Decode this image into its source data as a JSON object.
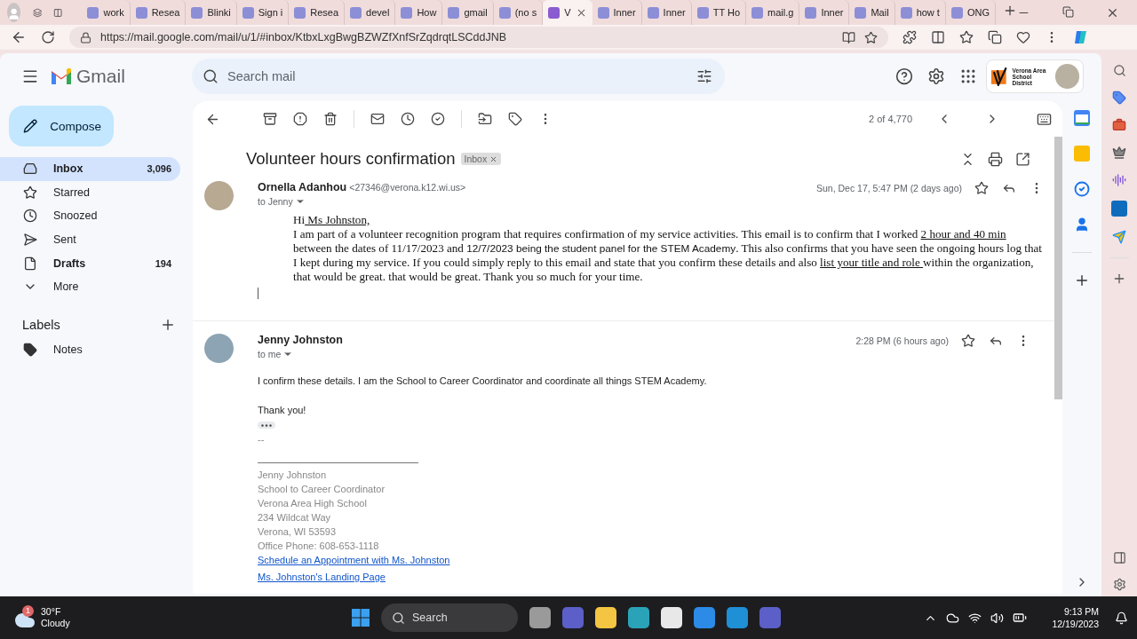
{
  "browser": {
    "tabs": [
      {
        "label": "work",
        "selected": false
      },
      {
        "label": "Resea",
        "selected": false
      },
      {
        "label": "Blinki",
        "selected": false
      },
      {
        "label": "Sign i",
        "selected": false
      },
      {
        "label": "Resea",
        "selected": false
      },
      {
        "label": "devel",
        "selected": false
      },
      {
        "label": "How",
        "selected": false
      },
      {
        "label": "gmail",
        "selected": false
      },
      {
        "label": "(no s",
        "selected": false
      },
      {
        "label": "V",
        "selected": true
      },
      {
        "label": "Inner",
        "selected": false
      },
      {
        "label": "Inner",
        "selected": false
      },
      {
        "label": "TT Ho",
        "selected": false
      },
      {
        "label": "mail.g",
        "selected": false
      },
      {
        "label": "Inner",
        "selected": false
      },
      {
        "label": "Mail",
        "selected": false
      },
      {
        "label": "how t",
        "selected": false
      },
      {
        "label": "ONG",
        "selected": false
      }
    ],
    "address": "https://mail.google.com/mail/u/1/#inbox/KtbxLxgBwgBZWZfXnfSrZqdrqtLSCddJNB"
  },
  "gmail": {
    "brand": "Gmail",
    "search_placeholder": "Search mail",
    "account": {
      "org_lines": [
        "Verona Area",
        "School District"
      ]
    },
    "compose": "Compose",
    "nav": [
      {
        "kind": "inbox",
        "label": "Inbox",
        "count": "3,096",
        "selected": true,
        "unread": true
      },
      {
        "kind": "starred",
        "label": "Starred",
        "selected": false,
        "unread": false
      },
      {
        "kind": "snoozed",
        "label": "Snoozed",
        "selected": false,
        "unread": false
      },
      {
        "kind": "sent",
        "label": "Sent",
        "selected": false,
        "unread": false
      },
      {
        "kind": "drafts",
        "label": "Drafts",
        "count": "194",
        "selected": false,
        "unread": true
      },
      {
        "kind": "more",
        "label": "More",
        "selected": false,
        "unread": false
      }
    ],
    "labels_title": "Labels",
    "labels": [
      {
        "label": "Notes"
      }
    ]
  },
  "toolbar": {
    "counter": "2 of 4,770"
  },
  "thread": {
    "subject": "Volunteer hours confirmation",
    "tag": "Inbox",
    "messages": [
      {
        "sender": "Ornella Adanhou",
        "email": "<27346@verona.k12.wi.us>",
        "to": "to Jenny",
        "date": "Sun, Dec 17, 5:47 PM (2 days ago)",
        "kind": "formatted",
        "body": [
          {
            "kind": "formatted",
            "segments": [
              {
                "text": "Hi",
                "underline": false,
                "kind": "plain"
              },
              {
                "text": " Ms Johnston,",
                "underline": true,
                "kind": "plain"
              }
            ]
          },
          {
            "kind": "formatted",
            "segments": [
              {
                "text": "I am part of a volunteer recognition program that requires confirmation of my service activities. This email is to confirm that I worked ",
                "underline": false,
                "kind": "plain"
              },
              {
                "text": "2 hour and 40 min",
                "underline": true,
                "kind": "plain"
              },
              {
                "text": " between the dates of 11/17/2023 and ",
                "underline": false,
                "kind": "plain"
              },
              {
                "text": "12/7/2023 being the student panel for the STEM Academy",
                "underline": false,
                "kind": "pasted"
              },
              {
                "text": ". This also confirms that you have seen the ongoing hours log that I kept during my service. If you could simply reply to this email and state that you confirm these details and also ",
                "underline": false,
                "kind": "plain"
              },
              {
                "text": "list your title and role ",
                "underline": true,
                "kind": "plain"
              },
              {
                "text": "within the organization, that would be great. that would be great. Thank you so much for your time.",
                "underline": false,
                "kind": "plain"
              }
            ]
          },
          {
            "kind": "cursor"
          }
        ]
      },
      {
        "sender": "Jenny Johnston",
        "to": "to me",
        "date": "2:28 PM (6 hours ago)",
        "kind": "plain",
        "body": [
          {
            "kind": "text",
            "text": "I confirm these details. I am the School to Career Coordinator and coordinate all things STEM Academy.",
            "space_before": false
          },
          {
            "kind": "text",
            "text": "Thank you!",
            "space_before": true
          },
          {
            "kind": "ellipsis"
          },
          {
            "kind": "muted",
            "text": "--",
            "space_before": false
          },
          {
            "kind": "rule"
          },
          {
            "kind": "muted",
            "text": "Jenny Johnston",
            "space_before": false
          },
          {
            "kind": "muted",
            "text": "School to Career Coordinator",
            "space_before": false
          },
          {
            "kind": "muted",
            "text": "Verona Area High School",
            "space_before": false
          },
          {
            "kind": "muted",
            "text": "234 Wildcat Way",
            "space_before": false
          },
          {
            "kind": "muted",
            "text": "Verona, WI 53593",
            "space_before": false
          },
          {
            "kind": "muted",
            "text": "Office Phone: 608-653-1118",
            "space_before": false
          },
          {
            "kind": "link",
            "text": "Schedule an Appointment with Ms. Johnston",
            "space_before": false
          },
          {
            "kind": "link",
            "text": "Ms. Johnston's Landing Page",
            "space_before": true
          }
        ]
      }
    ]
  },
  "taskbar": {
    "weather": {
      "badge": "1",
      "temp": "30°F",
      "condition": "Cloudy"
    },
    "search": "Search",
    "time": "9:13 PM",
    "date": "12/19/2023"
  }
}
